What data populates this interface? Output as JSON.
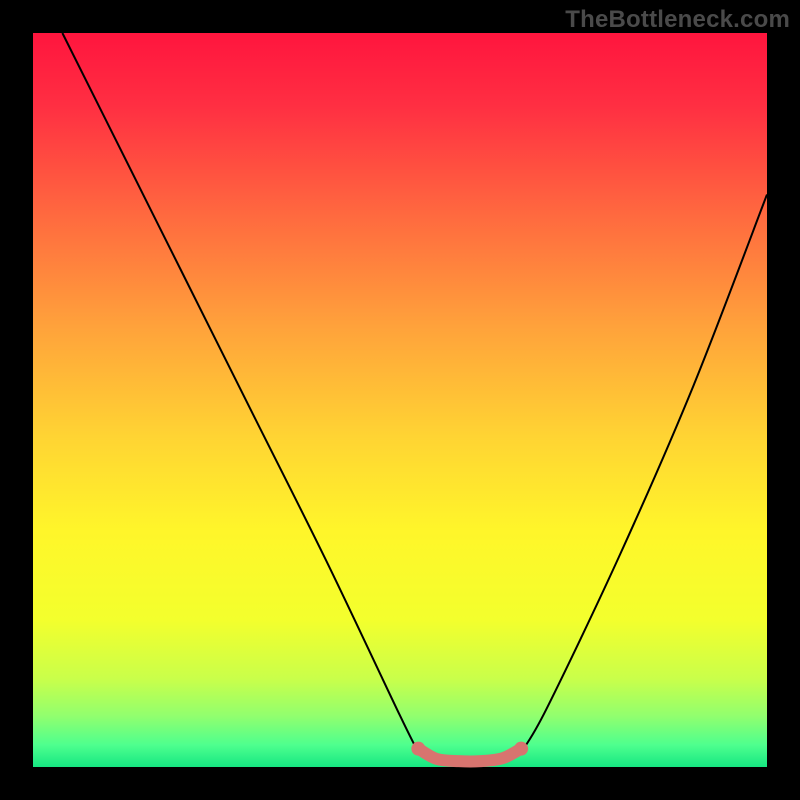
{
  "watermark": "TheBottleneck.com",
  "colors": {
    "frame": "#000000",
    "curve": "#000000",
    "optimal_stroke": "#d8746f",
    "endpoint_fill": "#d8746f",
    "gradient_stops": [
      {
        "offset": 0.0,
        "color": "#ff153e"
      },
      {
        "offset": 0.1,
        "color": "#ff2f42"
      },
      {
        "offset": 0.25,
        "color": "#ff6a3f"
      },
      {
        "offset": 0.4,
        "color": "#ffa23b"
      },
      {
        "offset": 0.55,
        "color": "#ffd433"
      },
      {
        "offset": 0.68,
        "color": "#fff62a"
      },
      {
        "offset": 0.8,
        "color": "#f3ff2d"
      },
      {
        "offset": 0.88,
        "color": "#c9ff4a"
      },
      {
        "offset": 0.93,
        "color": "#92ff6e"
      },
      {
        "offset": 0.97,
        "color": "#4eff8e"
      },
      {
        "offset": 1.0,
        "color": "#16e782"
      }
    ]
  },
  "chart_data": {
    "type": "line",
    "title": "",
    "xlabel": "",
    "ylabel": "",
    "x_range": [
      0,
      100
    ],
    "y_range": [
      0,
      100
    ],
    "series": [
      {
        "name": "left_curve",
        "x": [
          4.0,
          10,
          20,
          30,
          40,
          50,
          52.5
        ],
        "y": [
          100,
          88,
          68,
          48,
          28,
          7,
          2
        ]
      },
      {
        "name": "right_curve",
        "x": [
          66.5,
          70,
          80,
          90,
          100
        ],
        "y": [
          2,
          8,
          29,
          52,
          78
        ]
      },
      {
        "name": "optimal_zone",
        "x": [
          52.5,
          55,
          58,
          61,
          64,
          66.5
        ],
        "y": [
          2.5,
          1.1,
          0.8,
          0.8,
          1.2,
          2.5
        ]
      }
    ],
    "optimal_zone_style": {
      "stroke_width_px": 12,
      "endpoint_radius_px": 7
    },
    "annotations": []
  }
}
